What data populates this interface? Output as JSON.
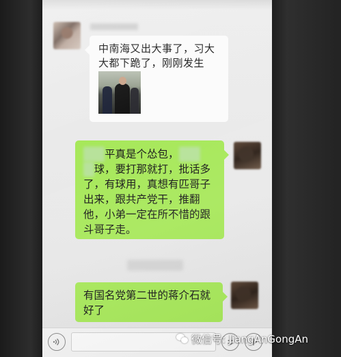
{
  "chat": {
    "incoming_message": {
      "text": "中南海又出大事了，习大大都下跪了，刚刚发生的!..."
    },
    "outgoing_message_1": {
      "redacted_1": "习近",
      "text_1": "平真是个怂包，",
      "redacted_2": "踢不",
      "redacted_3": "好",
      "text_2": "球，要打那就打，批话多了，有球用，真想有匹哥子出来，跟共产党干，推翻他，小弟一定在所不惜的跟斗哥子走。"
    },
    "outgoing_message_2": {
      "text": "有国名党第二世的蒋介石就好了"
    }
  },
  "input_bar": {
    "voice_icon": "voice-icon",
    "emoji_icon": "emoji-icon",
    "plus_icon": "plus-icon"
  },
  "watermark": {
    "text": "微信号: JiangAnGongAn"
  },
  "colors": {
    "outgoing_bubble": "#a7e85a",
    "incoming_bubble": "#fbfbfb",
    "chat_background": "#ededed"
  }
}
